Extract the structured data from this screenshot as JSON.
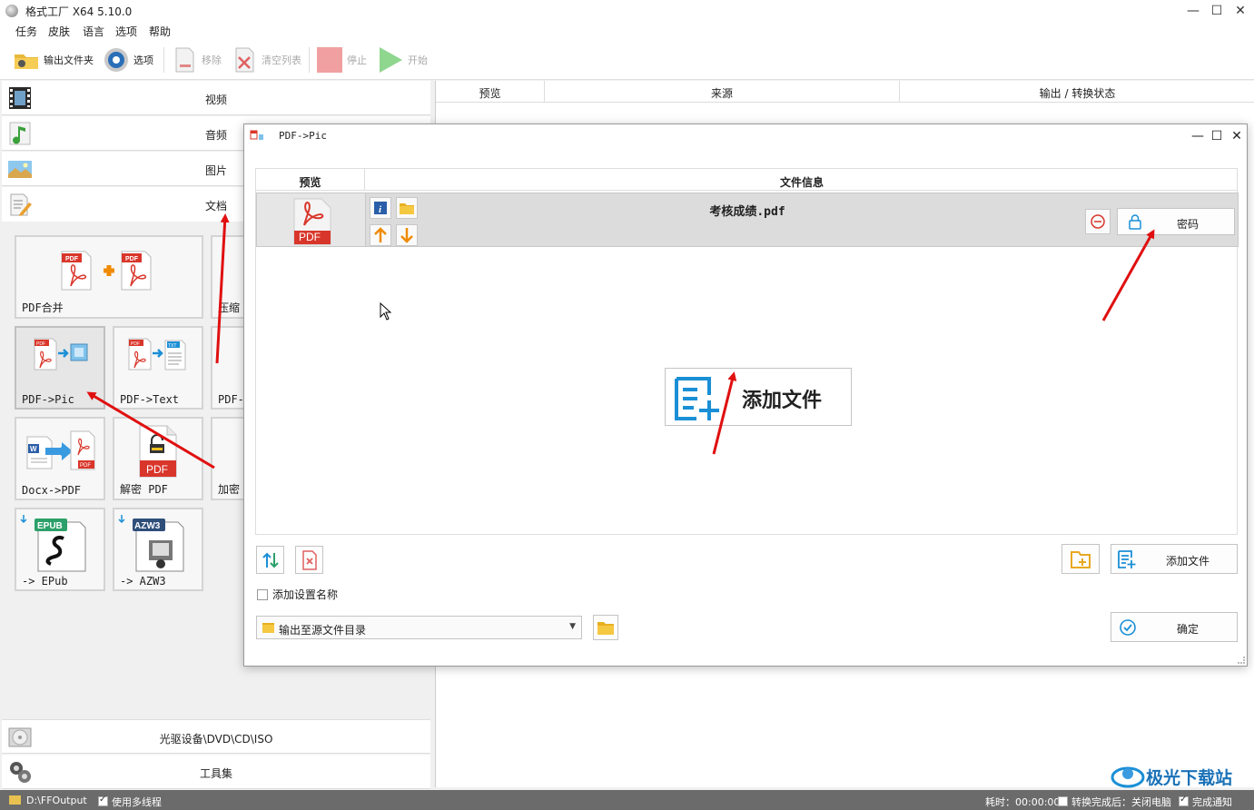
{
  "window": {
    "title": "格式工厂 X64 5.10.0",
    "controls": {
      "minimize": "—",
      "maximize": "☐",
      "close": "✕"
    }
  },
  "menu": [
    "任务",
    "皮肤",
    "语言",
    "选项",
    "帮助"
  ],
  "toolbar": {
    "output_folder": "输出文件夹",
    "options": "选项",
    "remove": "移除",
    "clear_list": "清空列表",
    "stop": "停止",
    "start": "开始"
  },
  "categories": {
    "video": "视频",
    "audio": "音频",
    "image": "图片",
    "document": "文档",
    "optical": "光驱设备\\DVD\\CD\\ISO",
    "toolbox": "工具集"
  },
  "doc_tiles": [
    {
      "label": "PDF合并"
    },
    {
      "label": "压缩"
    },
    {
      "label": "PDF->Pic"
    },
    {
      "label": "PDF->Text"
    },
    {
      "label": "PDF-"
    },
    {
      "label": "Docx->PDF"
    },
    {
      "label": "解密 PDF"
    },
    {
      "label": "加密"
    },
    {
      "label": "-> EPub"
    },
    {
      "label": "-> AZW3"
    }
  ],
  "task_list": {
    "columns": [
      "预览",
      "来源",
      "输出 / 转换状态"
    ]
  },
  "dialog": {
    "title": "PDF->Pic",
    "columns": {
      "preview": "预览",
      "file_info": "文件信息"
    },
    "file": {
      "name": "考核成绩.pdf",
      "thumb_label": "PDF"
    },
    "password_button": "密码",
    "add_file_big": "添加文件",
    "add_file_button": "添加文件",
    "add_setting_name": "添加设置名称",
    "output_dir": "输出至源文件目录",
    "ok_button": "确定"
  },
  "status": {
    "output_path": "D:\\FFOutput",
    "multithread": "使用多线程",
    "elapsed": "耗时：00:00:00",
    "after_done": "转换完成后：关闭电脑",
    "notify": "完成通知"
  },
  "watermark": "极光下载站",
  "colors": {
    "accent_blue": "#1a8fd6",
    "pdf_red": "#d9362b",
    "arrow_red": "#e01010",
    "status_bar": "#6b6b6b"
  }
}
